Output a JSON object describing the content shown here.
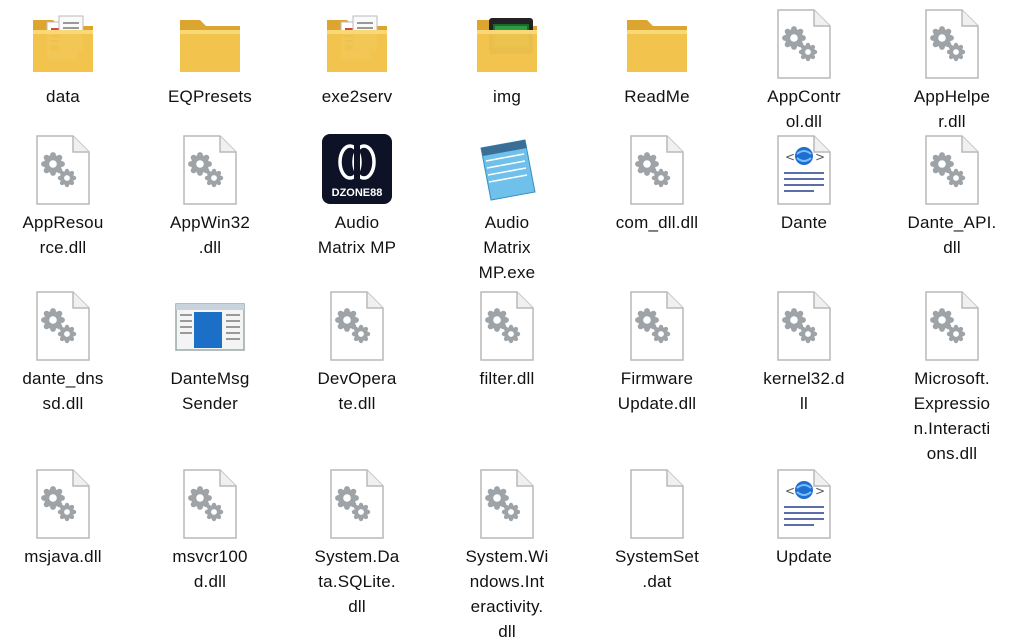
{
  "window": {
    "view": "Large icons"
  },
  "files": [
    {
      "id": "data",
      "lines": [
        "data"
      ],
      "icon": "folder-with-documents-icon"
    },
    {
      "id": "eqpresets",
      "lines": [
        "EQPresets"
      ],
      "icon": "folder-icon"
    },
    {
      "id": "exe2serv",
      "lines": [
        "exe2serv"
      ],
      "icon": "folder-with-documents-icon"
    },
    {
      "id": "img",
      "lines": [
        "img"
      ],
      "icon": "folder-with-screen-icon"
    },
    {
      "id": "readme",
      "lines": [
        "ReadMe"
      ],
      "icon": "folder-icon"
    },
    {
      "id": "appcontrol-dll",
      "lines": [
        "AppContr",
        "ol.dll"
      ],
      "icon": "dll-file-icon"
    },
    {
      "id": "apphelper-dll",
      "lines": [
        "AppHelpe",
        "r.dll"
      ],
      "icon": "dll-file-icon"
    },
    {
      "id": "appresource-dll",
      "lines": [
        "AppResou",
        "rce.dll"
      ],
      "icon": "dll-file-icon"
    },
    {
      "id": "appwin32-dll",
      "lines": [
        "AppWin32",
        ".dll"
      ],
      "icon": "dll-file-icon"
    },
    {
      "id": "audio-matrix-mp",
      "lines": [
        "Audio",
        "Matrix MP"
      ],
      "icon": "dzone88-app-icon",
      "badge": "DZONE88"
    },
    {
      "id": "audio-matrix-mp-exe",
      "lines": [
        "Audio",
        "Matrix",
        "MP.exe"
      ],
      "icon": "notepad-icon"
    },
    {
      "id": "com-dll-dll",
      "lines": [
        "com_dll.dll"
      ],
      "icon": "dll-file-icon"
    },
    {
      "id": "dante",
      "lines": [
        "Dante"
      ],
      "icon": "html-document-icon"
    },
    {
      "id": "dante-api-dll",
      "lines": [
        "Dante_API.",
        "dll"
      ],
      "icon": "dll-file-icon"
    },
    {
      "id": "dante-dnssd-dll",
      "lines": [
        "dante_dns",
        "sd.dll"
      ],
      "icon": "dll-file-icon"
    },
    {
      "id": "dantemsgsender",
      "lines": [
        "DanteMsg",
        "Sender"
      ],
      "icon": "app-window-icon"
    },
    {
      "id": "devoperate-dll",
      "lines": [
        "DevOpera",
        "te.dll"
      ],
      "icon": "dll-file-icon"
    },
    {
      "id": "filter-dll",
      "lines": [
        "filter.dll"
      ],
      "icon": "dll-file-icon"
    },
    {
      "id": "firmwareupdate-dll",
      "lines": [
        "Firmware",
        "Update.dll"
      ],
      "icon": "dll-file-icon"
    },
    {
      "id": "kernel32-dll",
      "lines": [
        "kernel32.d",
        "ll"
      ],
      "icon": "dll-file-icon"
    },
    {
      "id": "ms-expression-interactions-dll",
      "lines": [
        "Microsoft.",
        "Expressio",
        "n.Interacti",
        "ons.dll"
      ],
      "icon": "dll-file-icon"
    },
    {
      "id": "msjava-dll",
      "lines": [
        "msjava.dll"
      ],
      "icon": "dll-file-icon"
    },
    {
      "id": "msvcr100d-dll",
      "lines": [
        "msvcr100",
        "d.dll"
      ],
      "icon": "dll-file-icon"
    },
    {
      "id": "system-data-sqlite-dll",
      "lines": [
        "System.Da",
        "ta.SQLite.",
        "dll"
      ],
      "icon": "dll-file-icon"
    },
    {
      "id": "system-windows-interactivity-dll",
      "lines": [
        "System.Wi",
        "ndows.Int",
        "eractivity.",
        "dll"
      ],
      "icon": "dll-file-icon"
    },
    {
      "id": "systemset-dat",
      "lines": [
        "SystemSet",
        ".dat"
      ],
      "icon": "blank-file-icon"
    },
    {
      "id": "update",
      "lines": [
        "Update"
      ],
      "icon": "html-document-icon"
    }
  ],
  "colors": {
    "folder": "#f3c54f",
    "folder_dark": "#dca530",
    "file_border": "#b9b9b9",
    "gear": "#9ea3a8",
    "dzone_bg": "#0d1226",
    "ie_blue": "#1f6fd1",
    "notepad_blue": "#6fc0ea",
    "window_blue": "#1c6fc6"
  }
}
